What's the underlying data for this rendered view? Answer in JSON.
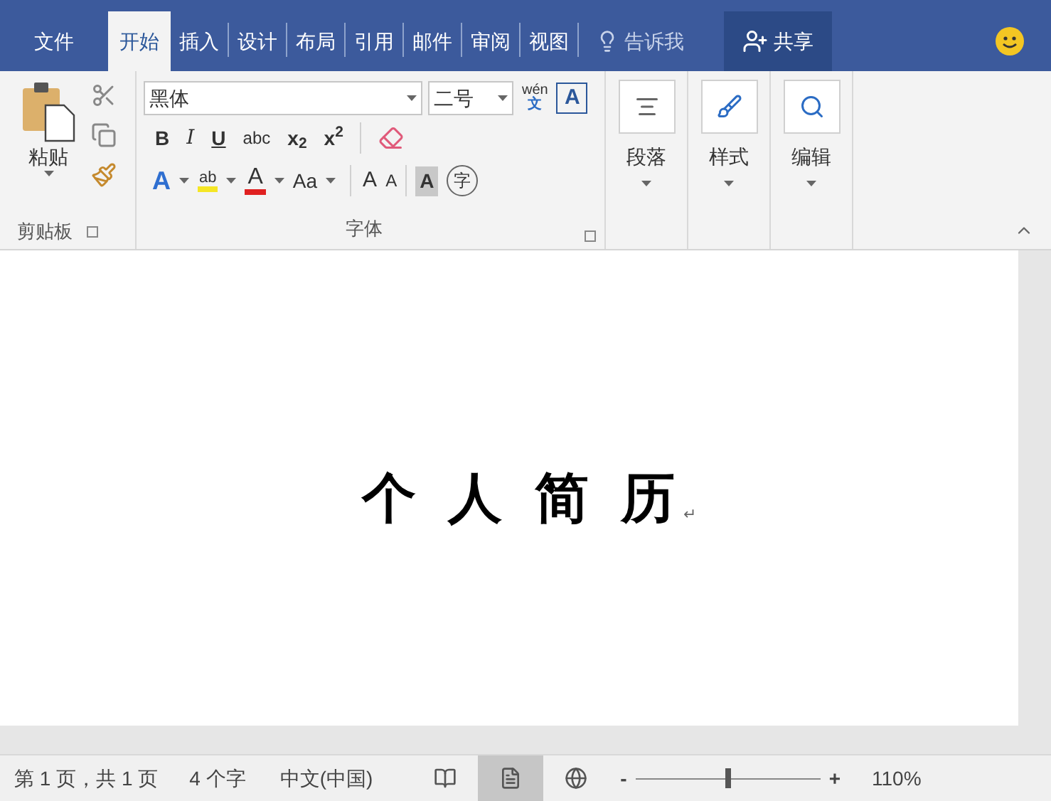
{
  "tab_bar": {
    "file_tab": "文件",
    "tabs": [
      {
        "label": "开始",
        "selected": true
      },
      {
        "label": "插入",
        "selected": false
      },
      {
        "label": "设计",
        "selected": false
      },
      {
        "label": "布局",
        "selected": false
      },
      {
        "label": "引用",
        "selected": false
      },
      {
        "label": "邮件",
        "selected": false
      },
      {
        "label": "审阅",
        "selected": false
      },
      {
        "label": "视图",
        "selected": false
      }
    ],
    "tell_me": "告诉我",
    "share": "共享"
  },
  "ribbon": {
    "clipboard": {
      "paste": "粘贴",
      "group_label": "剪贴板"
    },
    "font": {
      "font_name": "黑体",
      "font_size": "二号",
      "phonetic_top": "wén",
      "phonetic_bottom": "文",
      "border_char": "A",
      "format_buttons": [
        {
          "kind": "bold",
          "label": "B"
        },
        {
          "kind": "italic",
          "label": "I"
        },
        {
          "kind": "underline",
          "label": "U"
        },
        {
          "kind": "strike",
          "label": "abc"
        },
        {
          "kind": "plain",
          "label": "x$_{2}$"
        },
        {
          "kind": "plain",
          "label": "x$^{2}$"
        }
      ],
      "effect_char": "A",
      "highlight_char": "ab",
      "color_char": "A",
      "case_label": "Aa",
      "grow_char": "A",
      "shrink_char": "A",
      "shading_char": "A",
      "enclose_char": "字",
      "group_label": "字体"
    },
    "groups": [
      {
        "kind": "paragraph",
        "label": "段落"
      },
      {
        "kind": "styles",
        "label": "样式"
      },
      {
        "kind": "editing",
        "label": "编辑"
      }
    ]
  },
  "document": {
    "title": "个 人 简 历",
    "paragraph_mark": "↵"
  },
  "status_bar": {
    "page": "第 1 页，共 1 页",
    "words": "4 个字",
    "language": "中文(中国)",
    "views": [
      {
        "kind": "read",
        "selected": false
      },
      {
        "kind": "print",
        "selected": true
      },
      {
        "kind": "web",
        "selected": false
      }
    ],
    "zoom_minus": "-",
    "zoom_plus": "+",
    "zoom": {
      "level": 0.5
    },
    "zoom_percent": "110%"
  }
}
